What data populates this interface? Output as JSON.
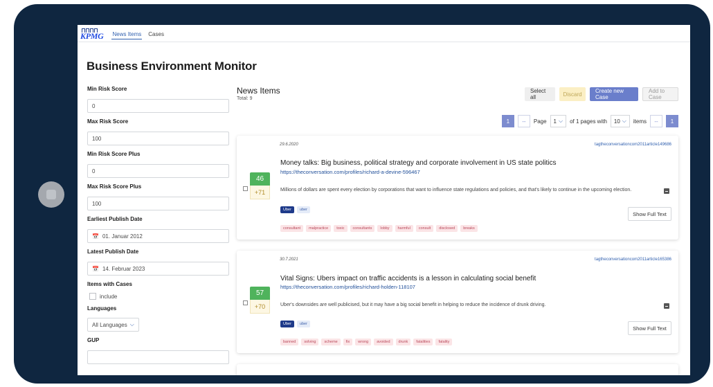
{
  "nav": {
    "logo": "KPMG",
    "tabs": [
      {
        "label": "News Items",
        "active": true
      },
      {
        "label": "Cases",
        "active": false
      }
    ]
  },
  "page_title": "Business Environment Monitor",
  "filters": {
    "min_risk_score": {
      "label": "Min Risk Score",
      "value": "0"
    },
    "max_risk_score": {
      "label": "Max Risk Score",
      "value": "100"
    },
    "min_risk_score_plus": {
      "label": "Min Risk Score Plus",
      "value": "0"
    },
    "max_risk_score_plus": {
      "label": "Max Risk Score Plus",
      "value": "100"
    },
    "earliest_publish_date": {
      "label": "Earliest Publish Date",
      "value": "01. Januar 2012"
    },
    "latest_publish_date": {
      "label": "Latest Publish Date",
      "value": "14. Februar 2023"
    },
    "items_with_cases": {
      "label": "Items with Cases",
      "checkbox_label": "include"
    },
    "languages": {
      "label": "Languages",
      "value": "All Languages"
    },
    "gup": {
      "label": "GUP",
      "value": ""
    }
  },
  "news": {
    "heading": "News Items",
    "total": "Total: 9",
    "actions": {
      "select_all": "Select all",
      "discard": "Discard",
      "create_new_case": "Create new Case",
      "add_to_case": "Add to Case"
    },
    "pagination": {
      "first": "1",
      "prev": "--",
      "page_label": "Page",
      "page_value": "1",
      "of_label": "of 1 pages with",
      "per_page_value": "10",
      "items_label": "items",
      "next": "--",
      "last": "1"
    },
    "items": [
      {
        "date": "29.6.2020",
        "source": "tagtheconversationcom2011article149686",
        "score": "46",
        "score_plus": "+71",
        "title": "Money talks: Big business, political strategy and corporate involvement in US state politics",
        "link": "https://theconversation.com/profiles/richard-a-devine-596467",
        "summary": "Millions of dollars are spent every election by corporations that want to influence state regulations and policies, and that's likely to continue in the upcoming election.",
        "tags": [
          "Uber",
          "uber"
        ],
        "keywords": [
          "consultant",
          "malpractice",
          "toxic",
          "consultants",
          "lobby",
          "harmful",
          "consult",
          "disclosed",
          "breaks"
        ],
        "show_full_text": "Show Full Text"
      },
      {
        "date": "30.7.2021",
        "source": "tagtheconversationcom2011article165386",
        "score": "57",
        "score_plus": "+70",
        "title": "Vital Signs: Ubers impact on traffic accidents is a lesson in calculating social benefit",
        "link": "https://theconversation.com/profiles/richard-holden-118107",
        "summary": "Uber's downsides are well publicised, but it may have a big social benefit in helping to reduce the incidence of drunk driving.",
        "tags": [
          "Uber",
          "uber"
        ],
        "keywords": [
          "banned",
          "solving",
          "scheme",
          "fix",
          "wrong",
          "avoided",
          "drunk",
          "fatalities",
          "fatality"
        ],
        "show_full_text": "Show Full Text"
      }
    ]
  },
  "icons": {
    "calendar": "calendar-icon",
    "chevron": "chevron-down-icon",
    "collapse": "minus-icon"
  },
  "colors": {
    "device_frame": "#0f2640",
    "accent": "#6a7ecb",
    "score_green": "#4fb35c",
    "score_plus_bg": "#fdf7e3",
    "keyword_bg": "#fbe4e6",
    "tag_dark": "#1e3a8a"
  }
}
